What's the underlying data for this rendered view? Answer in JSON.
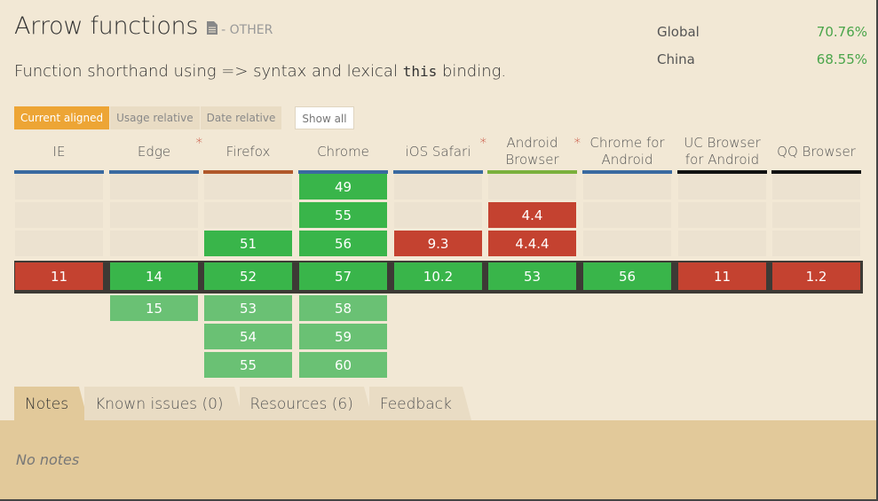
{
  "feature": {
    "title": "Arrow functions",
    "category": "- OTHER",
    "description_before": "Function shorthand using => syntax and lexical ",
    "description_code": "this",
    "description_after": " binding."
  },
  "usage": [
    {
      "label": "Global",
      "pct": "70.76%"
    },
    {
      "label": "China",
      "pct": "68.55%"
    }
  ],
  "filters": {
    "current_aligned": "Current aligned",
    "usage_relative": "Usage relative",
    "date_relative": "Date relative",
    "show_all": "Show all"
  },
  "browsers": [
    {
      "name": "IE",
      "star": "",
      "color": "#3a6aa0"
    },
    {
      "name": "Edge",
      "star": "*",
      "color": "#3a6aa0"
    },
    {
      "name": "Firefox",
      "star": "",
      "color": "#b0582a"
    },
    {
      "name": "Chrome",
      "star": "",
      "color": "#3a6aa0"
    },
    {
      "name": "iOS Safari",
      "star": "*",
      "color": "#3a6aa0"
    },
    {
      "name": "Android Browser",
      "star": "*",
      "color": "#7ab03c"
    },
    {
      "name": "Chrome for Android",
      "star": "",
      "color": "#3a6aa0"
    },
    {
      "name": "UC Browser for Android",
      "star": "",
      "color": "#111111"
    },
    {
      "name": "QQ Browser",
      "star": "",
      "color": "#111111"
    }
  ],
  "versions": {
    "IE": {
      "past": [
        "",
        "",
        ""
      ],
      "current": "11",
      "future": []
    },
    "Edge": {
      "past": [
        "",
        "",
        ""
      ],
      "current": "14",
      "future": [
        "15"
      ]
    },
    "Firefox": {
      "past": [
        "",
        "",
        "51"
      ],
      "current": "52",
      "future": [
        "53",
        "54",
        "55"
      ]
    },
    "Chrome": {
      "past": [
        "49",
        "55",
        "56"
      ],
      "current": "57",
      "future": [
        "58",
        "59",
        "60"
      ]
    },
    "iOS Safari": {
      "past": [
        "",
        "",
        "9.3"
      ],
      "current": "10.2",
      "future": []
    },
    "Android Browser": {
      "past": [
        "",
        "4.4",
        "4.4.4"
      ],
      "current": "53",
      "future": []
    },
    "Chrome for Android": {
      "past": [
        "",
        "",
        ""
      ],
      "current": "56",
      "future": []
    },
    "UC Browser for Android": {
      "past": [
        "",
        "",
        ""
      ],
      "current": "11",
      "future": []
    },
    "QQ Browser": {
      "past": [
        "",
        "",
        ""
      ],
      "current": "1.2",
      "future": []
    }
  },
  "support_status": {
    "IE": {
      "past": [
        "",
        "",
        ""
      ],
      "current": "red",
      "future": []
    },
    "Edge": {
      "past": [
        "",
        "",
        ""
      ],
      "current": "green",
      "future": [
        "lightgreen"
      ]
    },
    "Firefox": {
      "past": [
        "",
        "",
        "green"
      ],
      "current": "green",
      "future": [
        "lightgreen",
        "lightgreen",
        "lightgreen"
      ]
    },
    "Chrome": {
      "past": [
        "green",
        "green",
        "green"
      ],
      "current": "green",
      "future": [
        "lightgreen",
        "lightgreen",
        "lightgreen"
      ]
    },
    "iOS Safari": {
      "past": [
        "",
        "",
        "red"
      ],
      "current": "green",
      "future": []
    },
    "Android Browser": {
      "past": [
        "",
        "red",
        "red"
      ],
      "current": "green",
      "future": []
    },
    "Chrome for Android": {
      "past": [
        "",
        "",
        ""
      ],
      "current": "green",
      "future": []
    },
    "UC Browser for Android": {
      "past": [
        "",
        "",
        ""
      ],
      "current": "red",
      "future": []
    },
    "QQ Browser": {
      "past": [
        "",
        "",
        ""
      ],
      "current": "red",
      "future": []
    }
  },
  "tabs": [
    {
      "label": "Notes",
      "active": true
    },
    {
      "label": "Known issues (0)",
      "active": false
    },
    {
      "label": "Resources (6)",
      "active": false
    },
    {
      "label": "Feedback",
      "active": false
    }
  ],
  "notes_text": "No notes",
  "colors": {
    "supported": "#39b54a",
    "supported_future": "#6ac174",
    "unsupported": "#c44230",
    "accent": "#eda535"
  }
}
